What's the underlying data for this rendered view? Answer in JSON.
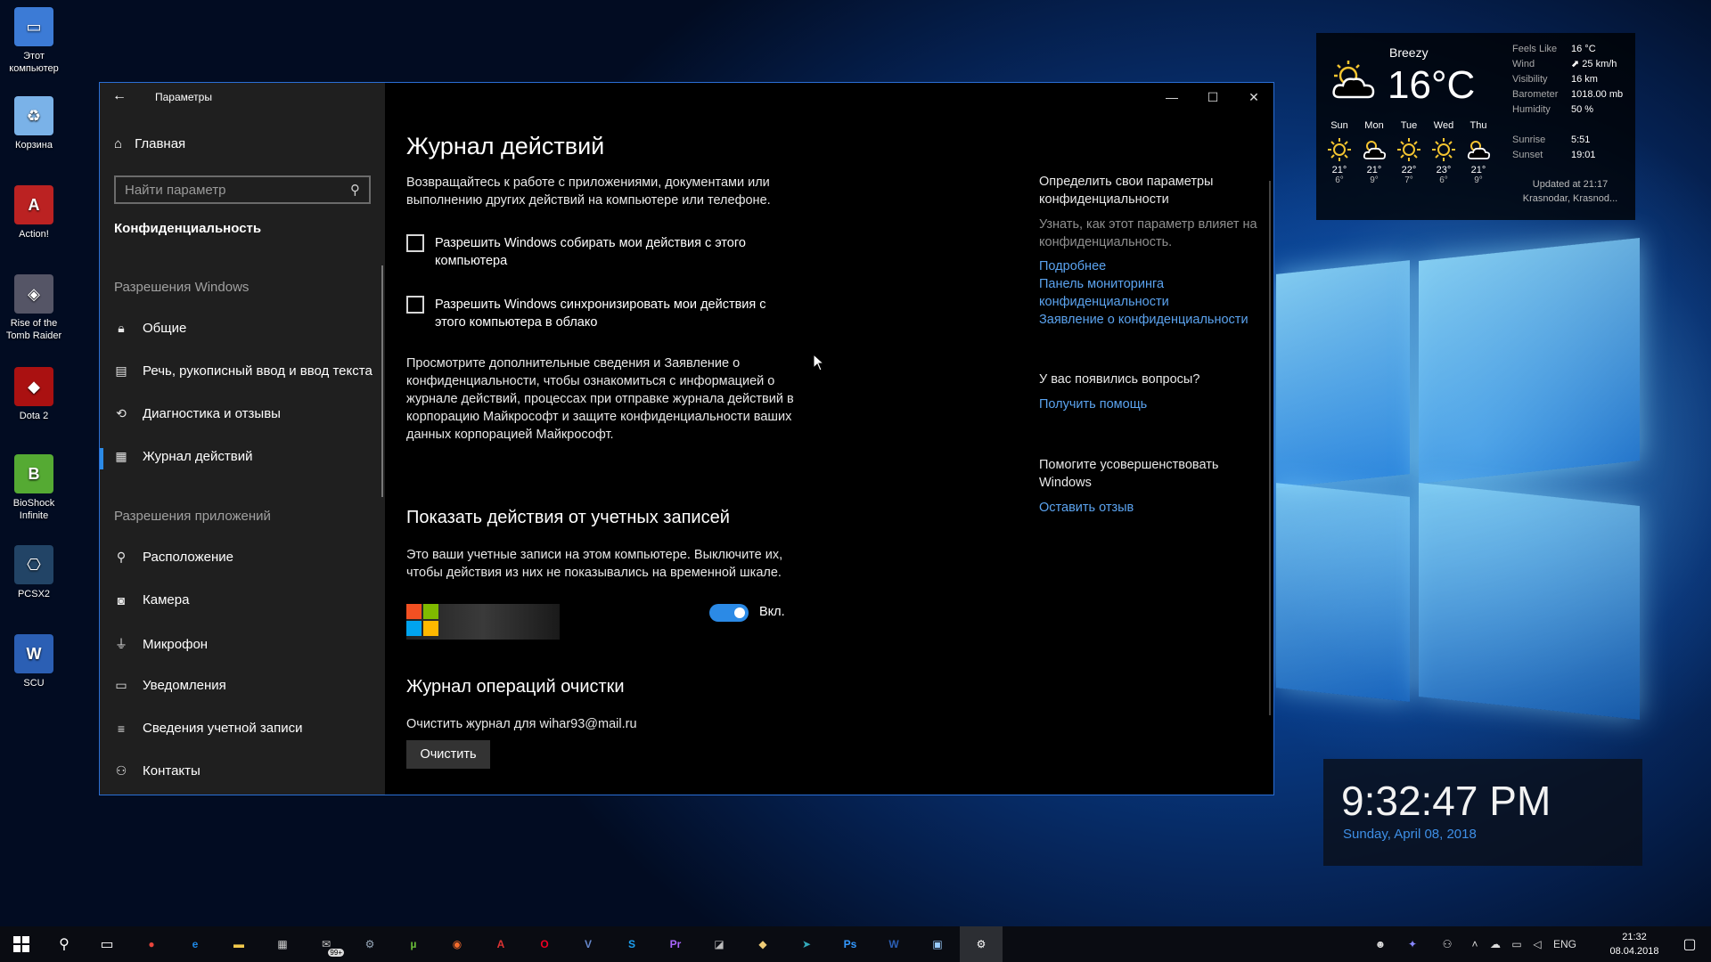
{
  "desktop": {
    "icons": [
      {
        "label": "Этот\nкомпьютер",
        "icon": "computer-icon"
      },
      {
        "label": "Корзина",
        "icon": "recycle-bin-icon"
      },
      {
        "label": "Action!",
        "icon": "action-icon"
      },
      {
        "label": "Rise of the\nTomb Raider",
        "icon": "tomb-raider-icon"
      },
      {
        "label": "Dota 2",
        "icon": "dota2-icon"
      },
      {
        "label": "BioShock\nInfinite",
        "icon": "bioshock-icon"
      },
      {
        "label": "PCSX2",
        "icon": "pcsx2-icon"
      },
      {
        "label": "SCU",
        "icon": "word-doc-icon"
      }
    ]
  },
  "window": {
    "title": "Параметры",
    "back_icon": "back-arrow-icon",
    "controls": {
      "minimize": "—",
      "maximize": "☐",
      "close": "✕"
    }
  },
  "sidebar": {
    "home_label": "Главная",
    "search_placeholder": "Найти параметр",
    "category": "Конфиденциальность",
    "group_windows": "Разрешения Windows",
    "windows_items": [
      {
        "label": "Общие",
        "icon": "lock-icon"
      },
      {
        "label": "Речь, рукописный ввод и ввод текста",
        "icon": "clipboard-icon"
      },
      {
        "label": "Диагностика и отзывы",
        "icon": "feedback-icon"
      },
      {
        "label": "Журнал действий",
        "icon": "timeline-icon",
        "active": true
      }
    ],
    "group_apps": "Разрешения приложений",
    "app_items": [
      {
        "label": "Расположение",
        "icon": "location-icon"
      },
      {
        "label": "Камера",
        "icon": "camera-icon"
      },
      {
        "label": "Микрофон",
        "icon": "microphone-icon"
      },
      {
        "label": "Уведомления",
        "icon": "notifications-icon"
      },
      {
        "label": "Сведения учетной записи",
        "icon": "account-info-icon"
      },
      {
        "label": "Контакты",
        "icon": "contacts-icon"
      }
    ]
  },
  "main": {
    "title": "Журнал действий",
    "intro": "Возвращайтесь к работе с приложениями, документами или выполнению других действий на компьютере или телефоне.",
    "checkbox1": "Разрешить Windows собирать мои действия с этого компьютера",
    "checkbox2": "Разрешить Windows синхронизировать мои действия с этого компьютера в облако",
    "info": "Просмотрите дополнительные сведения и Заявление о конфиденциальности, чтобы ознакомиться с информацией о журнале действий, процессах при отправке журнала действий в корпорацию Майкрософт и защите конфиденциальности ваших данных корпорацией Майкрософт.",
    "accounts_title": "Показать действия от учетных записей",
    "accounts_desc": "Это ваши учетные записи на этом компьютере. Выключите их, чтобы действия из них не показывались на временной шкале.",
    "toggle_state": "Вкл.",
    "clear_title": "Журнал операций очистки",
    "clear_desc": "Очистить журнал для wihar93@mail.ru",
    "clear_button": "Очистить"
  },
  "right": {
    "privacy_title": "Определить свои параметры конфиденциальности",
    "privacy_desc": "Узнать, как этот параметр влияет на конфиденциальность.",
    "link_more": "Подробнее",
    "link_dashboard": "Панель мониторинга конфиденциальности",
    "link_statement": "Заявление о конфиденциальности",
    "questions_title": "У вас появились вопросы?",
    "link_help": "Получить помощь",
    "improve_title": "Помогите усовершенствовать Windows",
    "link_feedback": "Оставить отзыв"
  },
  "weather": {
    "condition": "Breezy",
    "temp": "16°C",
    "forecast": [
      {
        "day": "Sun",
        "hi": "21°",
        "lo": "6°",
        "icon": "sun-icon"
      },
      {
        "day": "Mon",
        "hi": "21°",
        "lo": "9°",
        "icon": "partly-cloudy-icon"
      },
      {
        "day": "Tue",
        "hi": "22°",
        "lo": "7°",
        "icon": "sun-icon"
      },
      {
        "day": "Wed",
        "hi": "23°",
        "lo": "6°",
        "icon": "sun-icon"
      },
      {
        "day": "Thu",
        "hi": "21°",
        "lo": "9°",
        "icon": "partly-cloudy-icon"
      }
    ],
    "details": [
      {
        "k": "Feels Like",
        "v": "16 °C"
      },
      {
        "k": "Wind",
        "v": "⬈ 25 km/h"
      },
      {
        "k": "Visibility",
        "v": "16 km"
      },
      {
        "k": "Barometer",
        "v": "1018.00 mb"
      },
      {
        "k": "Humidity",
        "v": "50 %"
      }
    ],
    "sunrise": {
      "k": "Sunrise",
      "v": "5:51"
    },
    "sunset": {
      "k": "Sunset",
      "v": "19:01"
    },
    "updated": "Updated at 21:17",
    "location": "Krasnodar, Krasnod..."
  },
  "clock": {
    "time": "9:32:47 PM",
    "date": "Sunday, April 08, 2018"
  },
  "taskbar": {
    "apps": [
      {
        "name": "chrome",
        "glyph": "●",
        "color": "#e8453c"
      },
      {
        "name": "edge",
        "glyph": "e",
        "color": "#1e88e5"
      },
      {
        "name": "explorer",
        "glyph": "▬",
        "color": "#f2c94c"
      },
      {
        "name": "store",
        "glyph": "▦",
        "color": "#cccccc"
      },
      {
        "name": "mail",
        "glyph": "✉",
        "color": "#cccccc",
        "badge": "99+"
      },
      {
        "name": "steam",
        "glyph": "⚙",
        "color": "#9ab"
      },
      {
        "name": "utorrent",
        "glyph": "µ",
        "color": "#6bbf3a"
      },
      {
        "name": "origin",
        "glyph": "◉",
        "color": "#f56c2d"
      },
      {
        "name": "action",
        "glyph": "A",
        "color": "#d33"
      },
      {
        "name": "opera",
        "glyph": "O",
        "color": "#e02"
      },
      {
        "name": "visual-studio",
        "glyph": "V",
        "color": "#68c"
      },
      {
        "name": "skype",
        "glyph": "S",
        "color": "#1da1f2"
      },
      {
        "name": "premiere",
        "glyph": "Pr",
        "color": "#a6f"
      },
      {
        "name": "recorder",
        "glyph": "◪",
        "color": "#bbb"
      },
      {
        "name": "paint-3d",
        "glyph": "◆",
        "color": "#ec7"
      },
      {
        "name": "telegram",
        "glyph": "➤",
        "color": "#3ab"
      },
      {
        "name": "photoshop",
        "glyph": "Ps",
        "color": "#39f"
      },
      {
        "name": "word",
        "glyph": "W",
        "color": "#2b5fb4"
      },
      {
        "name": "capture",
        "glyph": "▣",
        "color": "#9cf"
      },
      {
        "name": "settings",
        "glyph": "⚙",
        "color": "#fff",
        "active": true
      }
    ],
    "tray_lang": "ENG",
    "tray_time": "21:32",
    "tray_date": "08.04.2018"
  }
}
